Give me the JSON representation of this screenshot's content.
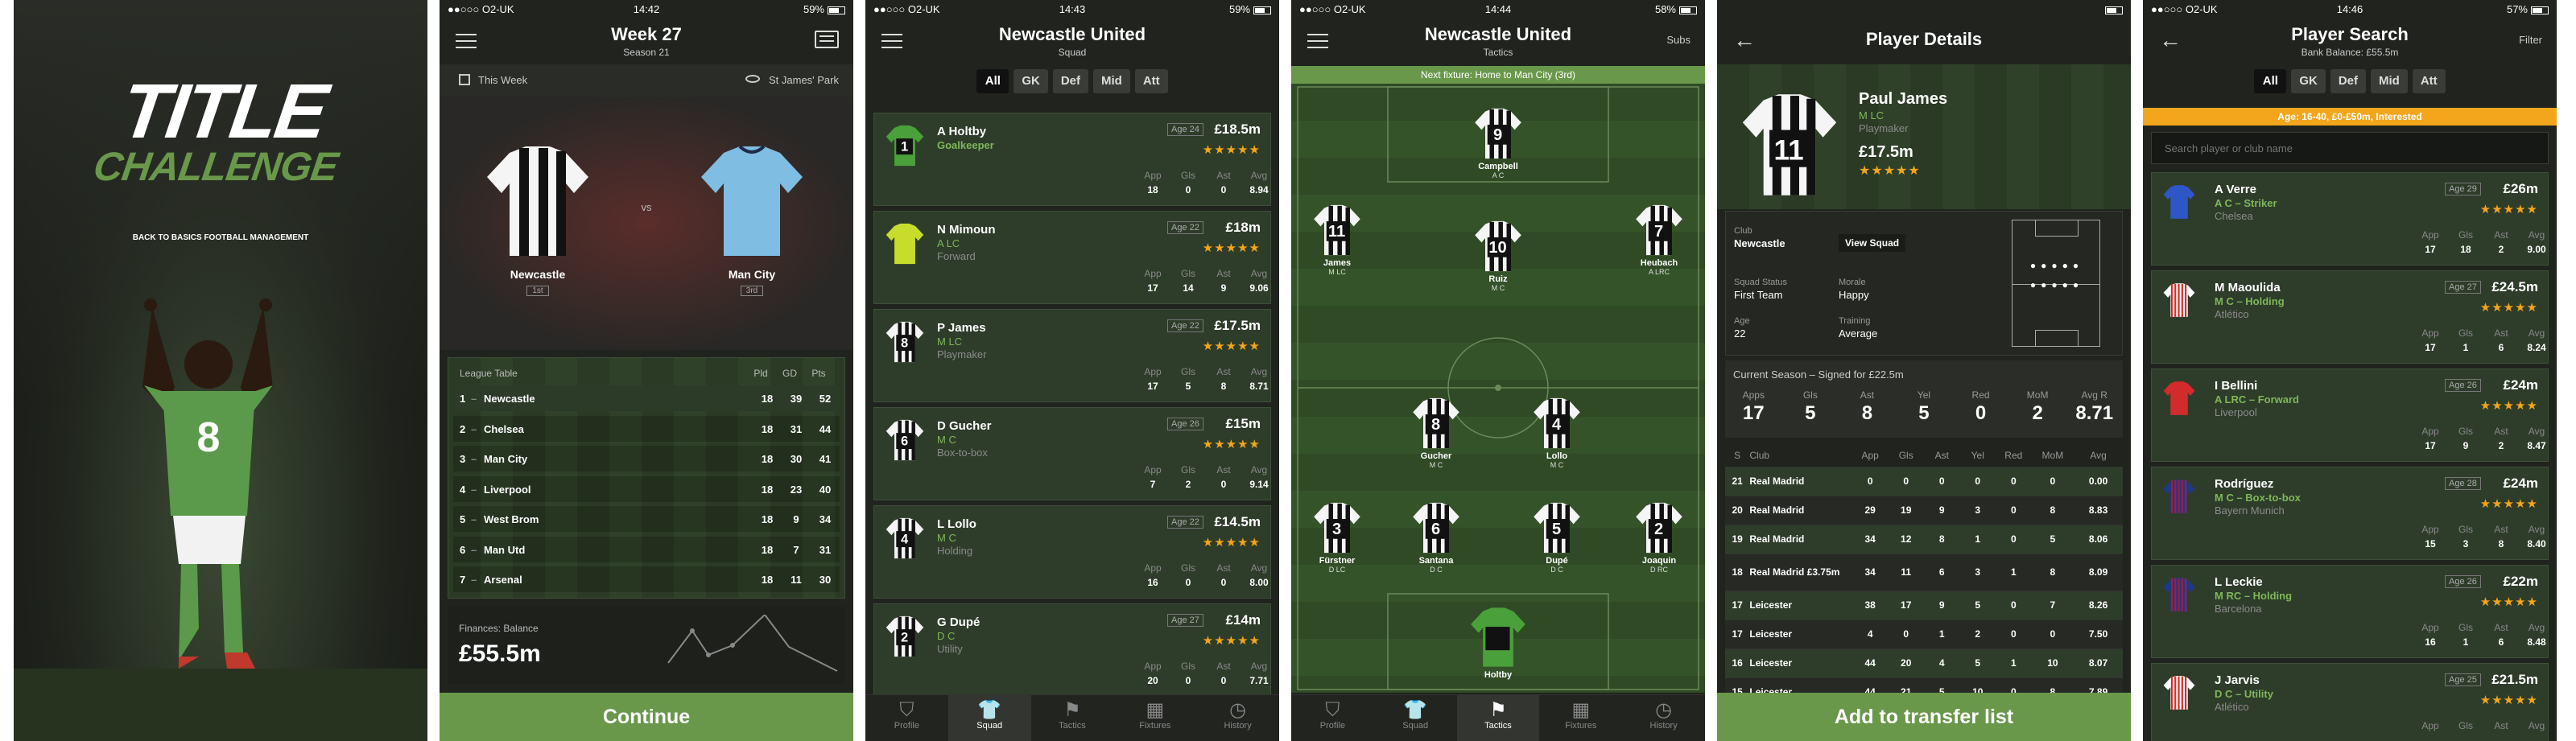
{
  "colors": {
    "accent": "#69984a",
    "star": "#f3a51b",
    "orange": "#f3a51b",
    "blue": "#3c62c6"
  },
  "splash": {
    "title1": "TITLE",
    "title2": "CHALLENGE",
    "tagline": "BACK TO BASICS FOOTBALL MANAGEMENT",
    "shirt_number": "8"
  },
  "s2": {
    "status": {
      "carrier": "●●○○○ O2-UK",
      "time": "14:42",
      "battery": "59%"
    },
    "title": "Week 27",
    "subtitle": "Season 21",
    "when": "This Week",
    "venue": "St James' Park",
    "home": {
      "name": "Newcastle",
      "pos": "1st"
    },
    "away": {
      "name": "Man City",
      "pos": "3rd"
    },
    "vs": "vs",
    "league": {
      "title": "League Table",
      "cols": [
        "Pld",
        "GD",
        "Pts"
      ],
      "rows": [
        [
          "1",
          "Newcastle",
          "18",
          "39",
          "52"
        ],
        [
          "2",
          "Chelsea",
          "18",
          "31",
          "44"
        ],
        [
          "3",
          "Man City",
          "18",
          "30",
          "41"
        ],
        [
          "4",
          "Liverpool",
          "18",
          "23",
          "40"
        ],
        [
          "5",
          "West Brom",
          "18",
          "9",
          "34"
        ],
        [
          "6",
          "Man Utd",
          "18",
          "7",
          "31"
        ],
        [
          "7",
          "Arsenal",
          "18",
          "11",
          "30"
        ]
      ]
    },
    "finances_label": "Finances: Balance",
    "balance": "£55.5m",
    "continue": "Continue"
  },
  "s3": {
    "status": {
      "carrier": "●●○○○ O2-UK",
      "time": "14:43",
      "battery": "59%"
    },
    "title": "Newcastle United",
    "subtitle": "Squad",
    "filters": [
      "All",
      "GK",
      "Def",
      "Mid",
      "Att"
    ],
    "stat_cols": [
      "App",
      "Gls",
      "Ast",
      "Avg"
    ],
    "players": [
      {
        "num": "1",
        "name": "A Holtby",
        "pos": "Goalkeeper",
        "role": "",
        "age": "Age 24",
        "value": "£18.5m",
        "stars": "★★★★★",
        "stats": [
          "18",
          "0",
          "0",
          "8.94"
        ],
        "gk": true
      },
      {
        "num": "",
        "name": "N Mimoun",
        "pos": "A LC",
        "role": "Forward",
        "age": "Age 22",
        "value": "£18m",
        "stars": "★★★★★",
        "stats": [
          "17",
          "14",
          "9",
          "9.06"
        ],
        "gk": false,
        "yellow": true
      },
      {
        "num": "8",
        "name": "P James",
        "pos": "M LC",
        "role": "Playmaker",
        "age": "Age 22",
        "value": "£17.5m",
        "stars": "★★★★★",
        "stats": [
          "17",
          "5",
          "8",
          "8.71"
        ],
        "gk": false
      },
      {
        "num": "6",
        "name": "D Gucher",
        "pos": "M C",
        "role": "Box-to-box",
        "age": "Age 26",
        "value": "£15m",
        "stars": "★★★★★",
        "stats": [
          "7",
          "2",
          "0",
          "9.14"
        ],
        "gk": false
      },
      {
        "num": "4",
        "name": "L Lollo",
        "pos": "M C",
        "role": "Holding",
        "age": "Age 22",
        "value": "£14.5m",
        "stars": "★★★★★",
        "stats": [
          "16",
          "0",
          "0",
          "8.00"
        ],
        "gk": false
      },
      {
        "num": "2",
        "name": "G Dupé",
        "pos": "D C",
        "role": "Utility",
        "age": "Age 27",
        "value": "£14m",
        "stars": "★★★★★",
        "stats": [
          "20",
          "0",
          "0",
          "7.71"
        ],
        "gk": false
      }
    ],
    "tabs": [
      "Profile",
      "Squad",
      "Tactics",
      "Fixtures",
      "History"
    ]
  },
  "s4": {
    "status": {
      "carrier": "●●○○○ O2-UK",
      "time": "14:44",
      "battery": "58%"
    },
    "title": "Newcastle United",
    "subtitle": "Tactics",
    "subs": "Subs",
    "fixture": "Next fixture: Home to Man City (3rd)",
    "players": [
      {
        "num": "9",
        "name": "Campbell",
        "pos": "A C"
      },
      {
        "num": "11",
        "name": "James",
        "pos": "M LC"
      },
      {
        "num": "10",
        "name": "Ruiz",
        "pos": "M C"
      },
      {
        "num": "7",
        "name": "Heubach",
        "pos": "A LRC"
      },
      {
        "num": "8",
        "name": "Gucher",
        "pos": "M C"
      },
      {
        "num": "4",
        "name": "Lollo",
        "pos": "M C"
      },
      {
        "num": "3",
        "name": "Fürstner",
        "pos": "D LC"
      },
      {
        "num": "6",
        "name": "Santana",
        "pos": "D C"
      },
      {
        "num": "5",
        "name": "Dupé",
        "pos": "D C"
      },
      {
        "num": "2",
        "name": "Joaquin",
        "pos": "D RC"
      },
      {
        "num": "1",
        "name": "Holtby",
        "pos": ""
      }
    ],
    "tabs": [
      "Profile",
      "Squad",
      "Tactics",
      "Fixtures",
      "History"
    ]
  },
  "s5": {
    "status": "First Team",
    "title": "Player Details",
    "shirt_number": "11",
    "name": "Paul James",
    "pos": "M LC",
    "role": "Playmaker",
    "value": "£17.5m",
    "stars": "★★★★★",
    "club_label": "Club",
    "club": "Newcastle",
    "view_squad": "View Squad",
    "status_label": "Squad Status",
    "morale_label": "Morale",
    "morale": "Happy",
    "age_label": "Age",
    "age": "22",
    "training_label": "Training",
    "training": "Average",
    "season_line": "Current Season – Signed for £22.5m",
    "season_cols": [
      "Apps",
      "Gls",
      "Ast",
      "Yel",
      "Red",
      "MoM",
      "Avg R"
    ],
    "season_vals": [
      "17",
      "5",
      "8",
      "5",
      "0",
      "2",
      "8.71"
    ],
    "hist_cols": [
      "S",
      "Club",
      "App",
      "Gls",
      "Ast",
      "Yel",
      "Red",
      "MoM",
      "Avg"
    ],
    "history": [
      [
        "21",
        "Real Madrid",
        "0",
        "0",
        "0",
        "0",
        "0",
        "0",
        "0.00"
      ],
      [
        "20",
        "Real Madrid",
        "29",
        "19",
        "9",
        "3",
        "0",
        "8",
        "8.83"
      ],
      [
        "19",
        "Real Madrid",
        "34",
        "12",
        "8",
        "1",
        "0",
        "5",
        "8.06"
      ],
      [
        "18",
        "Real Madrid £3.75m",
        "34",
        "11",
        "6",
        "3",
        "1",
        "8",
        "8.09"
      ],
      [
        "17",
        "Leicester",
        "38",
        "17",
        "9",
        "5",
        "0",
        "7",
        "8.26"
      ],
      [
        "17",
        "Leicester",
        "4",
        "0",
        "1",
        "2",
        "0",
        "0",
        "7.50"
      ],
      [
        "16",
        "Leicester",
        "44",
        "20",
        "4",
        "5",
        "1",
        "10",
        "8.07"
      ],
      [
        "15",
        "Leicester",
        "44",
        "21",
        "5",
        "10",
        "0",
        "8",
        "7.89"
      ]
    ],
    "add": "Add to transfer list"
  },
  "s6": {
    "status": {
      "carrier": "●●○○○ O2-UK",
      "time": "14:46",
      "battery": "57%"
    },
    "title": "Player Search",
    "subtitle": "Bank Balance: £55.5m",
    "filter": "Filter",
    "filters": [
      "All",
      "GK",
      "Def",
      "Mid",
      "Att"
    ],
    "banner": "Age: 16-40, £0-£50m, Interested",
    "search_placeholder": "Search player or club name",
    "stat_cols": [
      "App",
      "Gls",
      "Ast",
      "Avg"
    ],
    "players": [
      {
        "name": "A Verre",
        "pos": "A C – Striker",
        "club": "Chelsea",
        "age": "Age 29",
        "value": "£26m",
        "stars": "★★★★★",
        "stats": [
          "17",
          "18",
          "2",
          "9.00"
        ],
        "kit": "blue"
      },
      {
        "name": "M Maoulida",
        "pos": "M C – Holding",
        "club": "Atlético",
        "age": "Age 27",
        "value": "£24.5m",
        "stars": "★★★★★",
        "stats": [
          "17",
          "1",
          "6",
          "8.24"
        ],
        "kit": "stripe"
      },
      {
        "name": "I Bellini",
        "pos": "A LRC – Forward",
        "club": "Liverpool",
        "age": "Age 26",
        "value": "£24m",
        "stars": "★★★★★",
        "stats": [
          "17",
          "9",
          "2",
          "8.47"
        ],
        "kit": "red"
      },
      {
        "name": "Rodríguez",
        "pos": "M C – Box-to-box",
        "club": "Bayern Munich",
        "age": "Age 28",
        "value": "£24m",
        "stars": "★★★★★",
        "stats": [
          "15",
          "3",
          "8",
          "8.40"
        ],
        "kit": "barca"
      },
      {
        "name": "L Leckie",
        "pos": "M RC – Holding",
        "club": "Barcelona",
        "age": "Age 26",
        "value": "£22m",
        "stars": "★★★★★",
        "stats": [
          "16",
          "1",
          "6",
          "8.48"
        ],
        "kit": "barca"
      },
      {
        "name": "J Jarvis",
        "pos": "D C – Utility",
        "club": "Atlético",
        "age": "Age 25",
        "value": "£21.5m",
        "stars": "★★★★★",
        "stats": [
          "",
          "",
          "",
          ""
        ],
        "kit": "stripe"
      }
    ]
  }
}
